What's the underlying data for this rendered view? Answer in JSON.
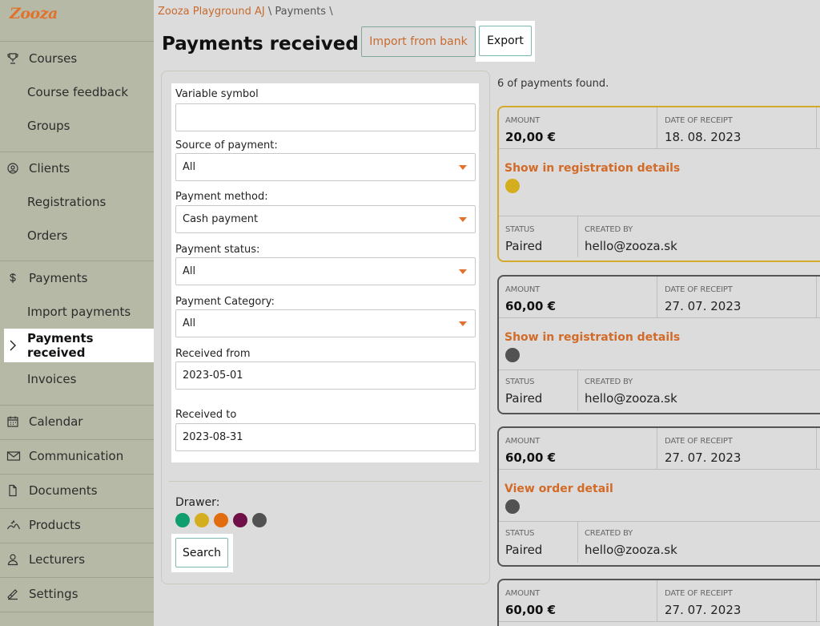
{
  "app": {
    "logo": "Zooza"
  },
  "breadcrumb": {
    "org": "Zooza Playground AJ",
    "sep1": "\\",
    "page": "Payments",
    "sep2": "\\"
  },
  "header": {
    "title": "Payments received",
    "import_label": "Import from bank",
    "export_label": "Export"
  },
  "sidebar": {
    "courses": "Courses",
    "course_feedback": "Course feedback",
    "groups": "Groups",
    "clients": "Clients",
    "registrations": "Registrations",
    "orders": "Orders",
    "payments": "Payments",
    "import_payments": "Import payments",
    "payments_received": "Payments received",
    "invoices": "Invoices",
    "calendar": "Calendar",
    "communication": "Communication",
    "documents": "Documents",
    "products": "Products",
    "lecturers": "Lecturers",
    "settings": "Settings"
  },
  "filters": {
    "variable_symbol": {
      "label": "Variable symbol",
      "value": ""
    },
    "source": {
      "label": "Source of payment:",
      "value": "All"
    },
    "method": {
      "label": "Payment method:",
      "value": "Cash payment"
    },
    "status": {
      "label": "Payment status:",
      "value": "All"
    },
    "category": {
      "label": "Payment Category:",
      "value": "All"
    },
    "received_from": {
      "label": "Received from",
      "value": "2023-05-01"
    },
    "received_to": {
      "label": "Received to",
      "value": "2023-08-31"
    },
    "drawer_label": "Drawer:",
    "drawer_colors": [
      "#0f9e6e",
      "#d4ae1e",
      "#e26d10",
      "#701048",
      "#525252"
    ],
    "search_label": "Search"
  },
  "results": {
    "count_text": "6 of payments found.",
    "labels": {
      "amount": "AMOUNT",
      "date": "DATE OF RECEIPT",
      "status": "STATUS",
      "created_by": "CREATED BY"
    },
    "cards": [
      {
        "amount": "20,00 €",
        "date": "18. 08. 2023",
        "link": "Show in registration details",
        "dot_color": "#d4ae1e",
        "status": "Paired",
        "created_by": "hello@zooza.sk"
      },
      {
        "amount": "60,00 €",
        "date": "27. 07. 2023",
        "link": "Show in registration details",
        "dot_color": "#525252",
        "status": "Paired",
        "created_by": "hello@zooza.sk"
      },
      {
        "amount": "60,00 €",
        "date": "27. 07. 2023",
        "link": "View order detail",
        "dot_color": "#525252",
        "status": "Paired",
        "created_by": "hello@zooza.sk"
      },
      {
        "amount": "60,00 €",
        "date": "27. 07. 2023"
      }
    ]
  },
  "colors": {
    "accent": "#e2712c",
    "sidebar_bg": "#b6b9a6",
    "highlight": "#d4aa2a"
  }
}
